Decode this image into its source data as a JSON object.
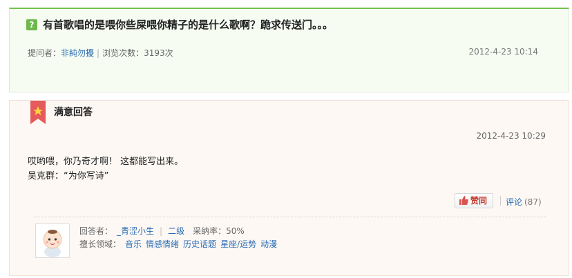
{
  "question": {
    "icon": "question-icon",
    "title": "有首歌唱的是喂你些屎喂你精子的是什么歌啊？跪求传送门。。。",
    "asker_label": "提问者：",
    "asker_name": "非純勿擾",
    "views_label": "浏览次数：",
    "views": "3193次",
    "time": "2012-4-23 10:14"
  },
  "answer": {
    "header": "满意回答",
    "time": "2012-4-23 10:29",
    "lines": [
      "哎哟喂，你乃奇才啊！ 这都能写出来。",
      "吴克群：“为你写诗”"
    ],
    "vote_label": "赞同",
    "comment_label": "评论",
    "comment_count": "(87)",
    "answerer_label": "回答者：",
    "answerer_name": "_青涩小生",
    "level": "二级",
    "adopt_rate_label": "采纳率：",
    "adopt_rate": "50%",
    "expertise_label": "擅长领域：",
    "expertise": [
      "音乐",
      "情感情绪",
      "历史话题",
      "星座/运势",
      "动漫"
    ]
  },
  "colors": {
    "green_accent": "#72c04a",
    "link": "#2b6cb5",
    "ribbon": "#e55a5a"
  }
}
